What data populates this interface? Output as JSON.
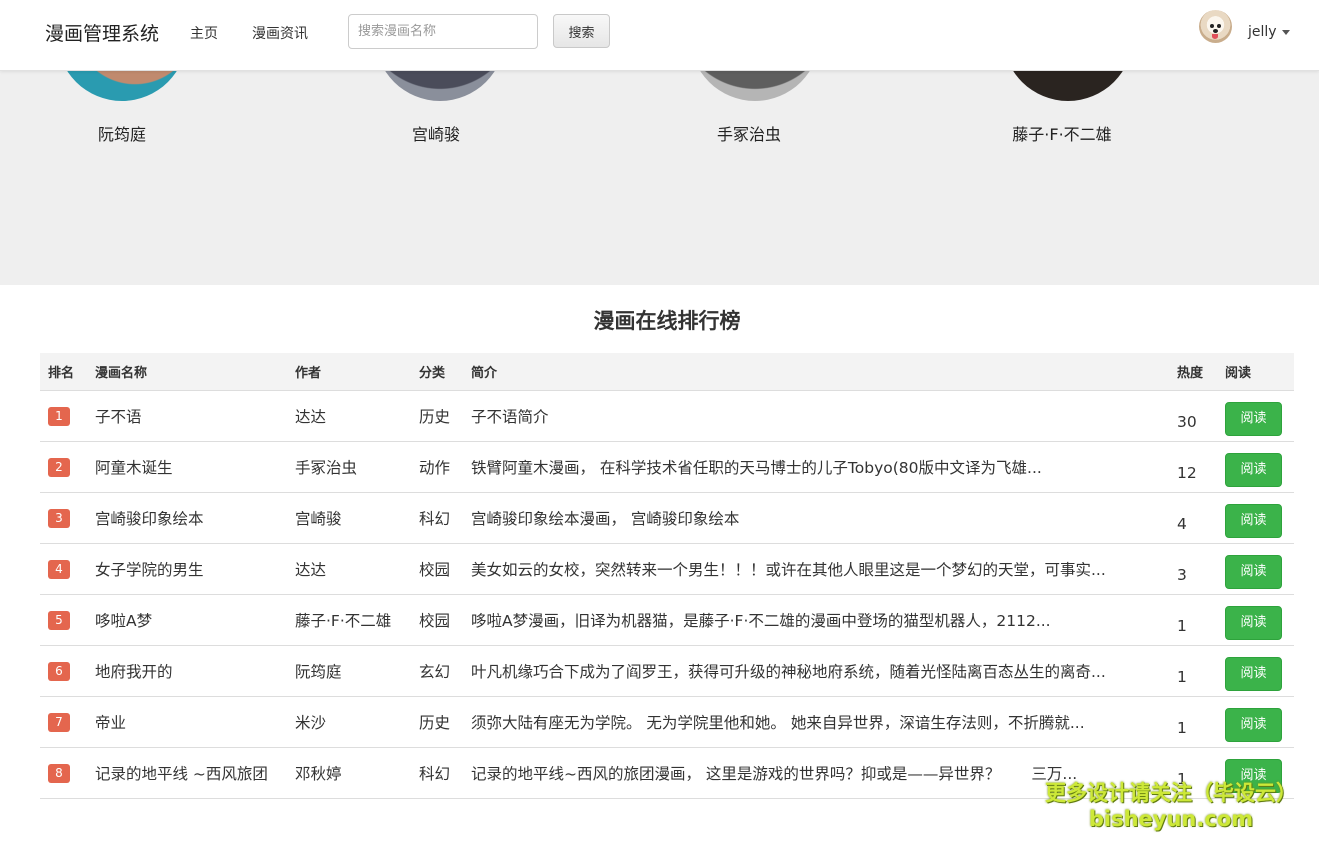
{
  "navbar": {
    "brand": "漫画管理系统",
    "links": [
      "主页",
      "漫画资讯"
    ],
    "search_placeholder": "搜索漫画名称",
    "search_button": "搜索",
    "user_name": "jelly"
  },
  "authors": [
    {
      "name": "阮筠庭"
    },
    {
      "name": "宫崎骏"
    },
    {
      "name": "手冢治虫"
    },
    {
      "name": "藤子·F·不二雄"
    }
  ],
  "ranking": {
    "title": "漫画在线排行榜",
    "headers": [
      "排名",
      "漫画名称",
      "作者",
      "分类",
      "简介",
      "热度",
      "阅读"
    ],
    "rows": [
      {
        "rank": "1",
        "name": "子不语",
        "author": "达达",
        "category": "历史",
        "intro": "子不语简介",
        "hot": "30",
        "read": "阅读"
      },
      {
        "rank": "2",
        "name": "阿童木诞生",
        "author": "手冢治虫",
        "category": "动作",
        "intro": "铁臂阿童木漫画， 在科学技术省任职的天马博士的儿子Tobyo(80版中文译为飞雄...",
        "hot": "12",
        "read": "阅读"
      },
      {
        "rank": "3",
        "name": "宫崎骏印象绘本",
        "author": "宫崎骏",
        "category": "科幻",
        "intro": "宫崎骏印象绘本漫画， 宫崎骏印象绘本",
        "hot": "4",
        "read": "阅读"
      },
      {
        "rank": "4",
        "name": "女子学院的男生",
        "author": "达达",
        "category": "校园",
        "intro": "美女如云的女校，突然转来一个男生！！！或许在其他人眼里这是一个梦幻的天堂，可事实...",
        "hot": "3",
        "read": "阅读"
      },
      {
        "rank": "5",
        "name": "哆啦A梦",
        "author": "藤子·F·不二雄",
        "category": "校园",
        "intro": "哆啦A梦漫画，旧译为机器猫，是藤子·F·不二雄的漫画中登场的猫型机器人，2112...",
        "hot": "1",
        "read": "阅读"
      },
      {
        "rank": "6",
        "name": "地府我开的",
        "author": "阮筠庭",
        "category": "玄幻",
        "intro": "叶凡机缘巧合下成为了阎罗王，获得可升级的神秘地府系统，随着光怪陆离百态丛生的离奇...",
        "hot": "1",
        "read": "阅读"
      },
      {
        "rank": "7",
        "name": "帝业",
        "author": "米沙",
        "category": "历史",
        "intro": "须弥大陆有座无为学院。 无为学院里他和她。 她来自异世界，深谙生存法则，不折腾就...",
        "hot": "1",
        "read": "阅读"
      },
      {
        "rank": "8",
        "name": "记录的地平线 ~西风旅团",
        "author": "邓秋婷",
        "category": "科幻",
        "intro": "记录的地平线~西风的旅团漫画， 这里是游戏的世界吗？抑或是——异世界？　　三万...",
        "hot": "1",
        "read": "阅读"
      }
    ]
  },
  "watermark": {
    "line1": "更多设计请关注（毕设云）",
    "line2": "bisheyun.com"
  },
  "colors": {
    "rank_badge": "#e4664e",
    "read_button": "#3bb34a",
    "band_bg": "#efefef"
  }
}
